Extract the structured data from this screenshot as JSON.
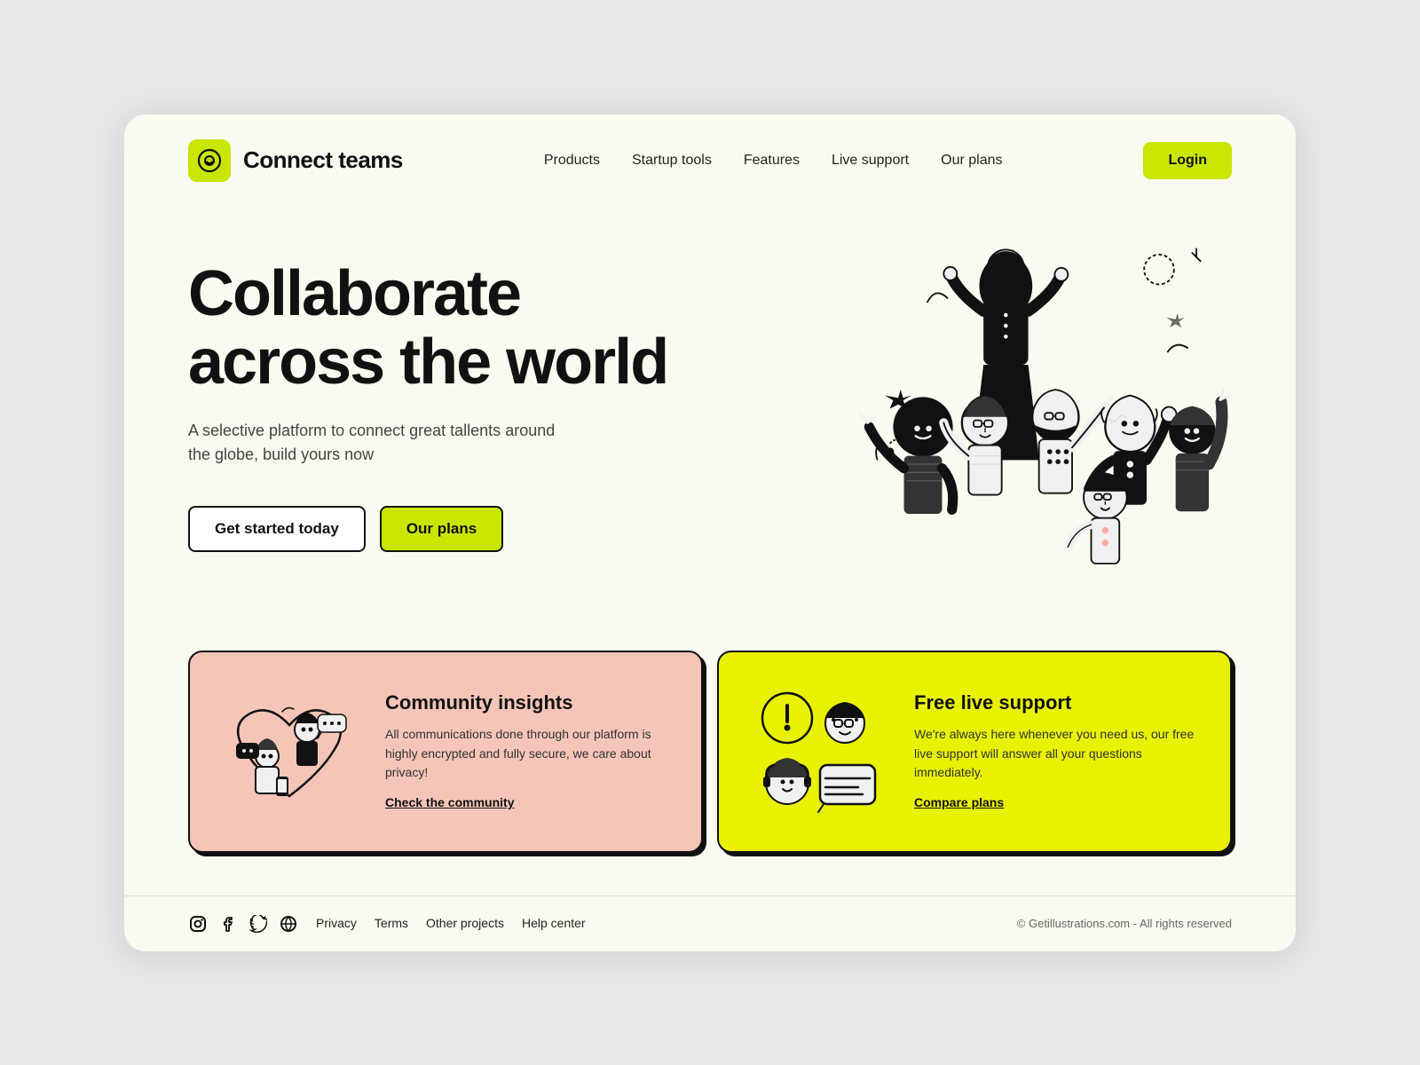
{
  "brand": {
    "name": "Connect teams",
    "logo_alt": "Connect teams logo"
  },
  "nav": {
    "links": [
      {
        "label": "Products",
        "href": "#"
      },
      {
        "label": "Startup tools",
        "href": "#"
      },
      {
        "label": "Features",
        "href": "#"
      },
      {
        "label": "Live support",
        "href": "#"
      },
      {
        "label": "Our plans",
        "href": "#"
      }
    ],
    "login_label": "Login"
  },
  "hero": {
    "title_line1": "Collaborate",
    "title_line2": "across the world",
    "subtitle": "A selective platform to connect great tallents around the globe, build yours now",
    "cta_primary": "Get started today",
    "cta_secondary": "Our plans"
  },
  "cards": [
    {
      "id": "community",
      "title": "Community insights",
      "description": "All communications done through our platform is highly encrypted and fully secure, we care about privacy!",
      "link_label": "Check the community",
      "bg": "pink"
    },
    {
      "id": "support",
      "title": "Free live support",
      "description": "We're always here whenever you need us, our free live support will answer all your questions immediately.",
      "link_label": "Compare plans",
      "bg": "yellow"
    }
  ],
  "footer": {
    "links": [
      {
        "label": "Privacy"
      },
      {
        "label": "Terms"
      },
      {
        "label": "Other projects"
      },
      {
        "label": "Help center"
      }
    ],
    "copyright": "© Getillustrations.com - All rights reserved"
  },
  "colors": {
    "accent": "#c8e600",
    "pink_card": "#f5c5b8",
    "yellow_card": "#e8f200"
  }
}
